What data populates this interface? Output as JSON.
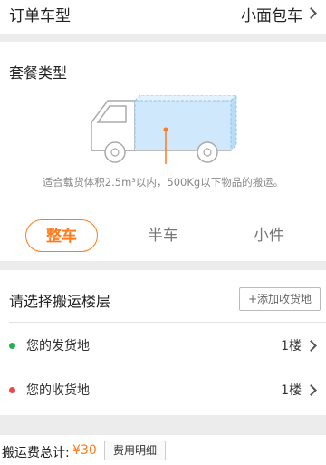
{
  "order_type": {
    "title": "订单车型",
    "value": "小面包车"
  },
  "package": {
    "title": "套餐类型",
    "description": "适合载货体积2.5m³以内，500Kg以下物品的搬运。",
    "tabs": [
      {
        "label": "整车",
        "active": true
      },
      {
        "label": "半车",
        "active": false
      },
      {
        "label": "小件",
        "active": false
      }
    ]
  },
  "floors": {
    "title": "请选择搬运楼层",
    "add_button": "添加收货地",
    "rows": [
      {
        "label": "您的发货地",
        "value": "1楼",
        "dot_color": "#22b24c"
      },
      {
        "label": "您的收货地",
        "value": "1楼",
        "dot_color": "#e84a4a"
      }
    ]
  },
  "footer": {
    "fee_label": "搬运费总计:",
    "fee_amount": "¥30",
    "detail_button": "费用明细"
  },
  "colors": {
    "accent": "#ff7a1c",
    "truck_cargo": "#cfe8fb"
  }
}
